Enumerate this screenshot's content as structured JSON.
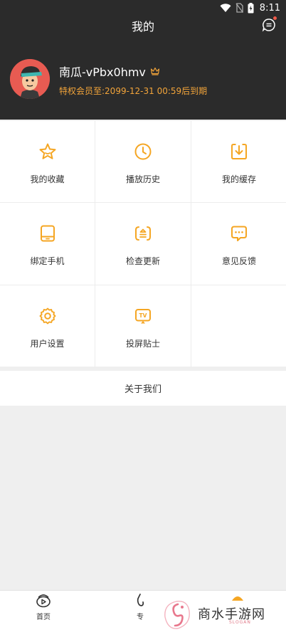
{
  "status_bar": {
    "time": "8:11"
  },
  "nav": {
    "title": "我的"
  },
  "profile": {
    "username": "南瓜-vPbx0hmv",
    "vip_text": "特权会员至:2099-12-31 00:59后到期"
  },
  "colors": {
    "accent": "#f5a623",
    "header_bg": "#2b2b2b",
    "vip_text": "#f2a43a"
  },
  "grid": {
    "items": [
      {
        "label": "我的收藏",
        "icon": "star-icon"
      },
      {
        "label": "播放历史",
        "icon": "clock-icon"
      },
      {
        "label": "我的缓存",
        "icon": "download-icon"
      },
      {
        "label": "绑定手机",
        "icon": "tablet-icon"
      },
      {
        "label": "检查更新",
        "icon": "update-icon"
      },
      {
        "label": "意见反馈",
        "icon": "chat-icon"
      },
      {
        "label": "用户设置",
        "icon": "gear-icon"
      },
      {
        "label": "投屏贴士",
        "icon": "tv-icon"
      }
    ]
  },
  "about": {
    "label": "关于我们"
  },
  "tabbar": {
    "items": [
      {
        "label": "首页",
        "icon": "play-icon"
      },
      {
        "label": "专",
        "icon": "topic-icon"
      },
      {
        "label": "",
        "icon": "mine-icon"
      }
    ]
  },
  "watermark": {
    "text": "商水手游网",
    "sub": "SLOGAN"
  }
}
